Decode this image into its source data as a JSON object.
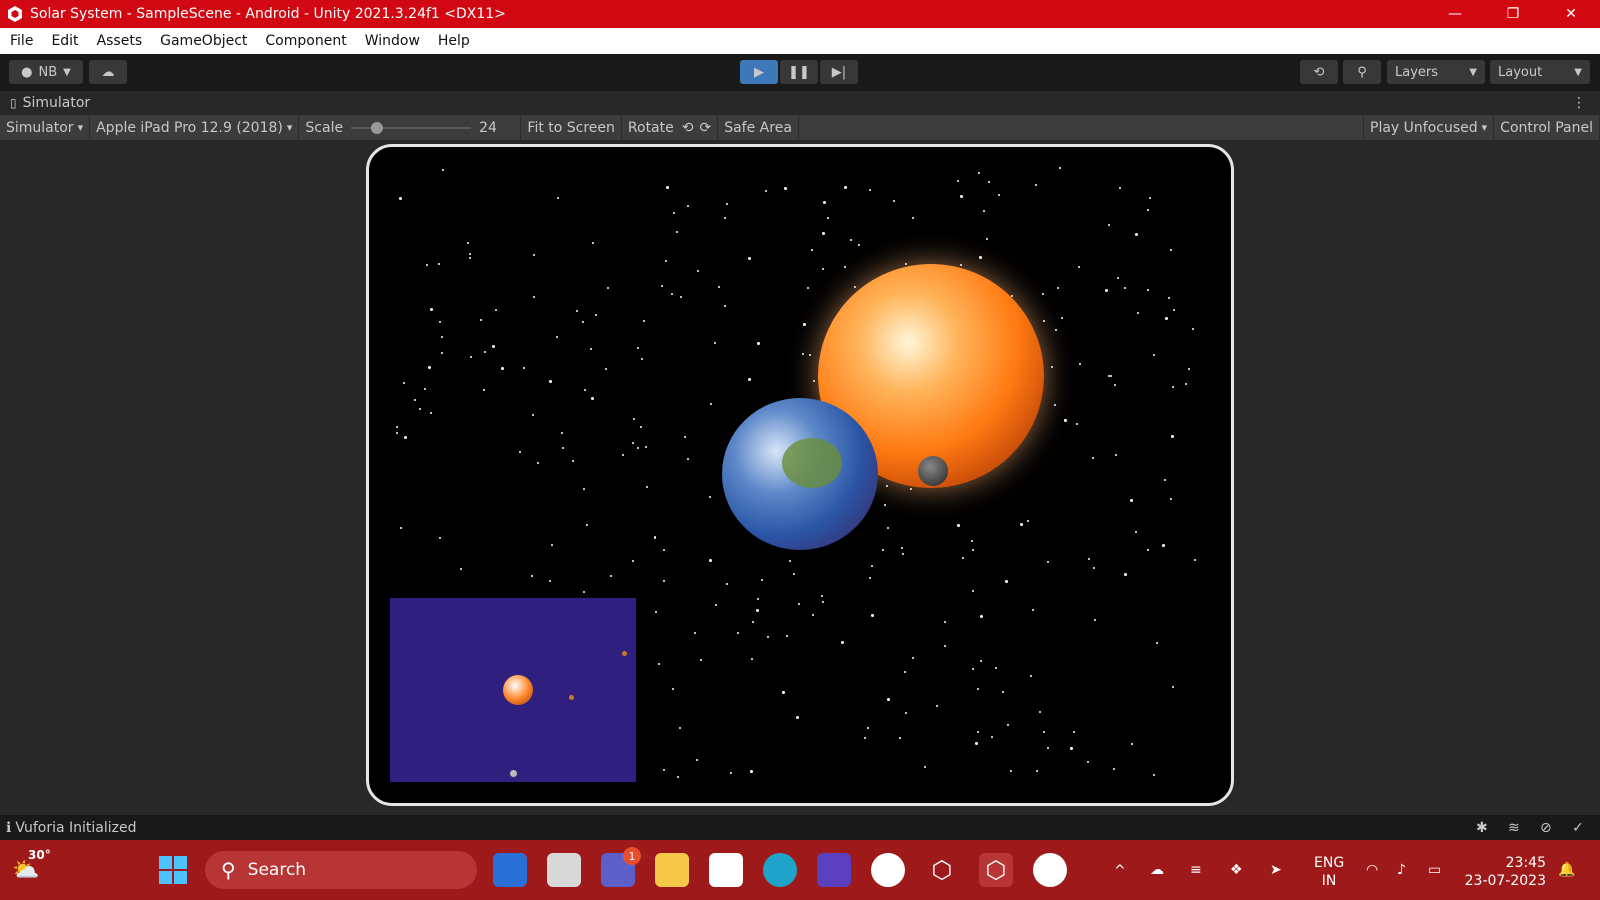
{
  "window": {
    "title": "Solar System - SampleScene - Android - Unity 2021.3.24f1 <DX11>",
    "controls": {
      "minimize": "—",
      "restore": "❐",
      "close": "✕"
    }
  },
  "menu": [
    "File",
    "Edit",
    "Assets",
    "GameObject",
    "Component",
    "Window",
    "Help"
  ],
  "toolbar": {
    "account": "NB",
    "layers": "Layers",
    "layout": "Layout"
  },
  "simulator": {
    "panel_title": "Simulator",
    "view_mode": "Simulator",
    "device": "Apple iPad Pro 12.9 (2018)",
    "scale_label": "Scale",
    "scale_value": "24",
    "fit_to_screen": "Fit to Screen",
    "rotate": "Rotate",
    "safe_area": "Safe Area",
    "play_mode": "Play Unfocused",
    "control_panel": "Control Panel"
  },
  "status": {
    "message": "Vuforia Initialized"
  },
  "taskbar": {
    "weather_temp": "30°",
    "search_placeholder": "Search",
    "chat_badge": "1",
    "lang": "ENG",
    "region": "IN",
    "time": "23:45",
    "date": "23-07-2023"
  },
  "colors": {
    "titlebar": "#d10812",
    "taskbar": "#9e1a1a",
    "minimap": "#2f1f7e",
    "play_active": "#3e78b9"
  }
}
